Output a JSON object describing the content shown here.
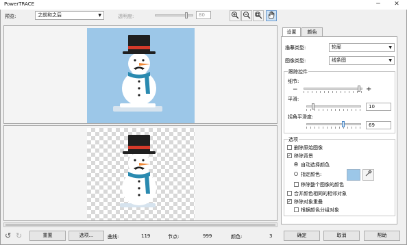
{
  "window": {
    "title": "PowerTRACE",
    "minimize_glyph": "─",
    "close_glyph": "✕"
  },
  "toolbar": {
    "preview_label": "预览:",
    "preview_value": "之前和之后",
    "transparency_label": "透明度:",
    "transparency_value": "80",
    "icons": [
      "zoom-in-icon",
      "zoom-out-icon",
      "zoom-fit-icon",
      "pan-hand-icon"
    ]
  },
  "tabs": [
    "设置",
    "颜色"
  ],
  "settings": {
    "trace_type_label": "描摹类型:",
    "trace_type_value": "轮廓",
    "image_type_label": "图像类型:",
    "image_type_value": "线条图",
    "trace_controls_title": "跟踪控件",
    "detail_label": "细节:",
    "detail_minus": "−",
    "detail_plus": "+",
    "detail_level": 0.97,
    "smoothing_label": "平滑:",
    "smoothing_value": "10",
    "smoothing_level": 0.1,
    "corner_label": "拐角平滑度:",
    "corner_value": "69",
    "corner_level": 0.69
  },
  "options": {
    "title": "选项",
    "delete_original": {
      "label": "删除原始图像",
      "checked": false
    },
    "remove_background": {
      "label": "移除背景",
      "checked": true
    },
    "auto_color": {
      "label": "自动选择颜色",
      "selected": true
    },
    "specify_color": {
      "label": "指定颜色:",
      "selected": false
    },
    "swatch_color": "#9cc7e8",
    "remove_whole_color": {
      "label": "移除整个图像的颜色",
      "checked": false
    },
    "merge_adjacent": {
      "label": "合并颜色相同的相邻对象",
      "checked": false
    },
    "remove_overlap": {
      "label": "移除对象重叠",
      "checked": true
    },
    "group_by_color": {
      "label": "根据颜色分组对象",
      "checked": false
    }
  },
  "bottom": {
    "reset_label": "重置",
    "options_label": "选项...",
    "curves_label": "曲线:",
    "curves_value": "119",
    "nodes_label": "节点:",
    "nodes_value": "999",
    "colors_label": "颜色:",
    "colors_value": "3",
    "ok_label": "确定",
    "cancel_label": "取消",
    "help_label": "帮助"
  },
  "colors": {
    "sky": "#9cc7e8",
    "scarf": "#2a8ab0",
    "hat": "#1f1f1f",
    "hat_band": "#d63a2a",
    "nose": "#f08a3a",
    "snow": "#ffffff",
    "shadow": "#d6e3ee"
  }
}
